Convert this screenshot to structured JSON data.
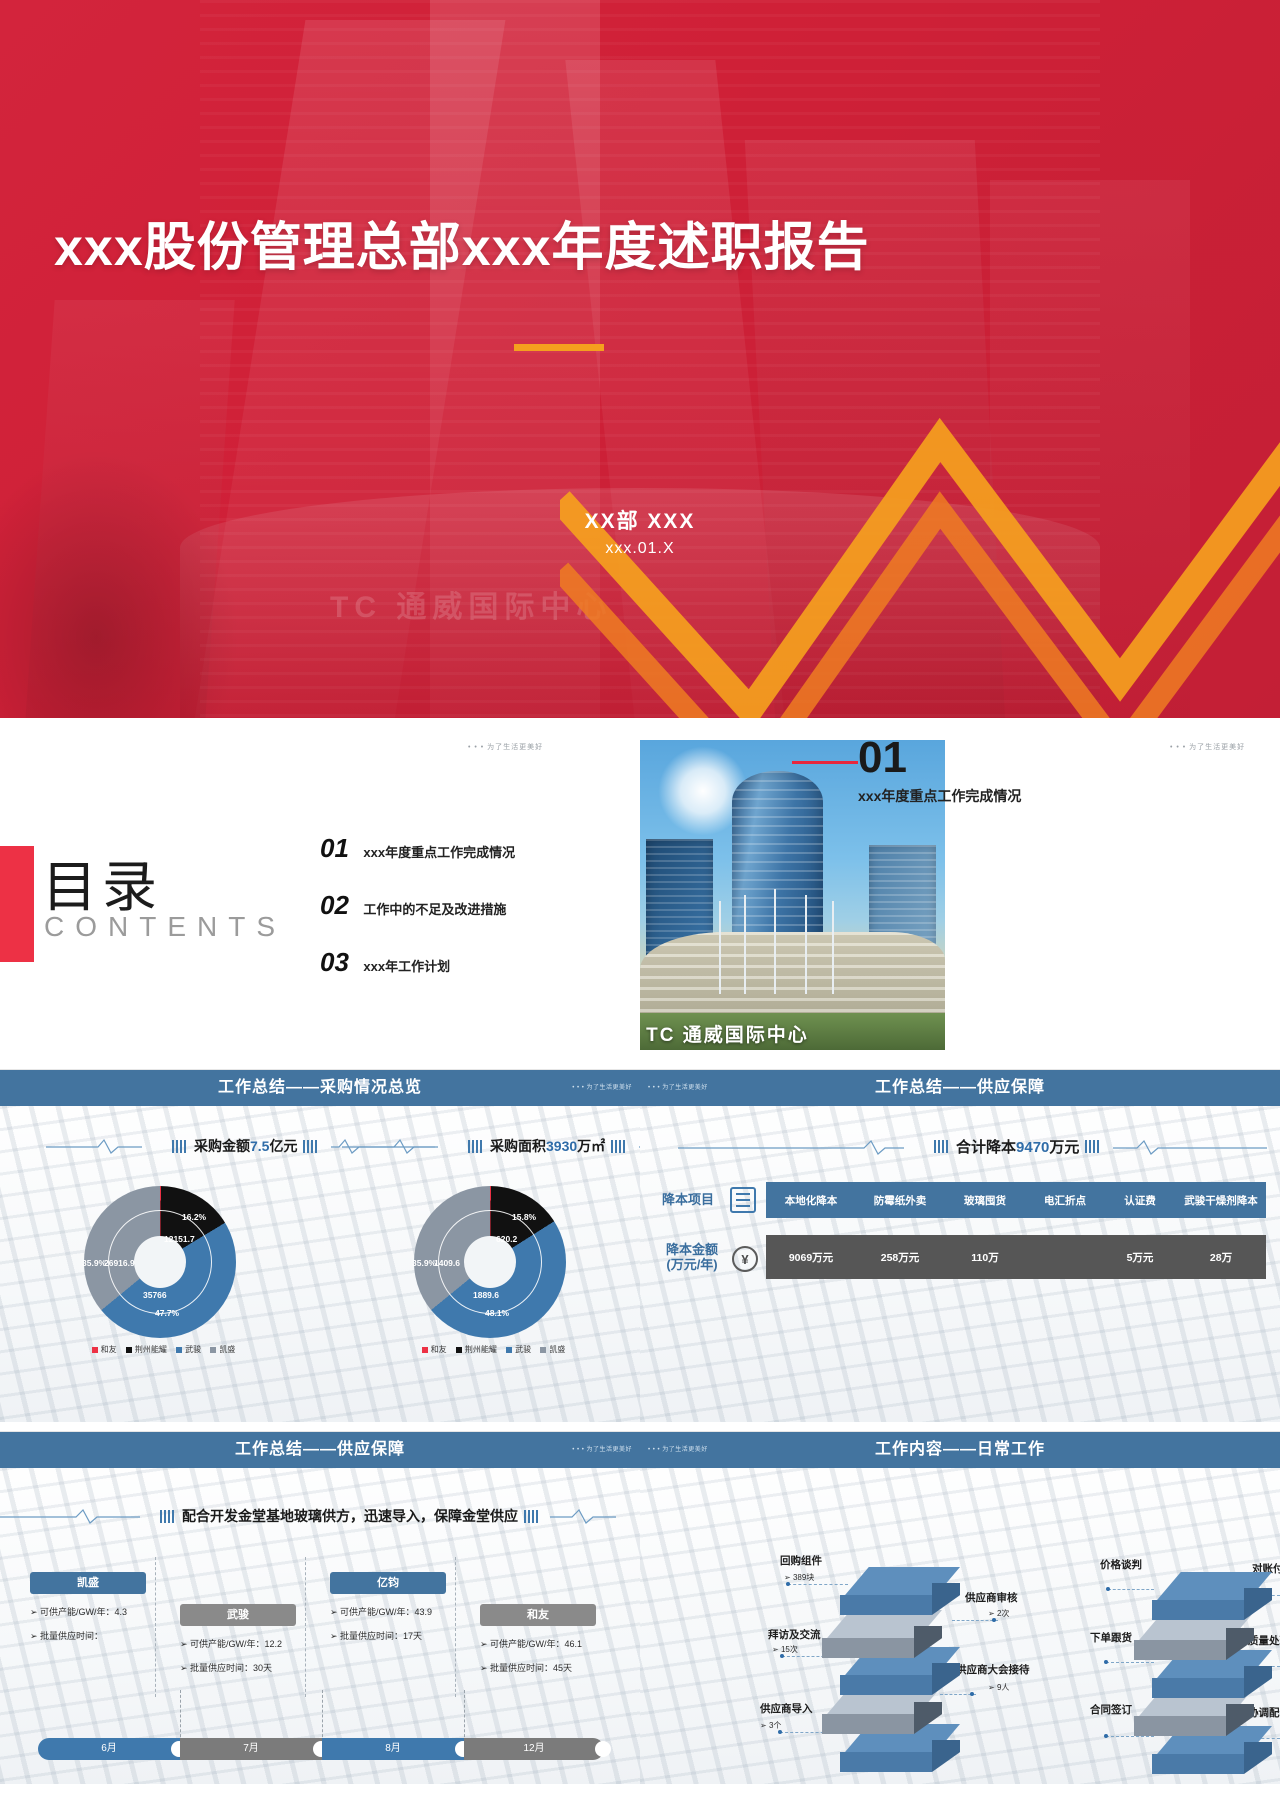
{
  "colors": {
    "brand_red": "#d3243c",
    "accent_orange": "#f5a01e",
    "header_blue": "#43749f",
    "table_gray": "#565656",
    "toc_red": "#ed3145"
  },
  "slide1": {
    "title": "xxx股份管理总部xxx年度述职报告",
    "presenter": "XX部  XXX",
    "date": "xxx.01.X",
    "watermark": "TC 通威国际中心"
  },
  "slide2": {
    "heading_cn": "目录",
    "heading_en": "CONTENTS",
    "corner_dots": "• • •  为了生活更美好",
    "toc": [
      {
        "num": "01",
        "label": "xxx年度重点工作完成情况"
      },
      {
        "num": "02",
        "label": "工作中的不足及改进措施"
      },
      {
        "num": "03",
        "label": "xxx年工作计划"
      }
    ],
    "section": {
      "num": "01",
      "label": "xxx年度重点工作完成情况",
      "photo_caption": "TC 通威国际中心"
    }
  },
  "slide3": {
    "header_title": "工作总结——采购情况总览",
    "header_dots": "• • •  为了生活更美好",
    "charts": [
      {
        "heading_prefix": "采购金额",
        "heading_value": "7.5",
        "heading_suffix": "亿元",
        "outer_labels": [
          "16.2%",
          "47.7%",
          "35.9%"
        ],
        "inner_labels": [
          "12151.7",
          "35766",
          "26916.9"
        ],
        "legend": [
          "和友",
          "荆州能耀",
          "武骏",
          "凯盛"
        ]
      },
      {
        "heading_prefix": "采购面积",
        "heading_value": "3930",
        "heading_suffix": "万㎡",
        "outer_labels": [
          "15.8%",
          "48.1%",
          "35.9%"
        ],
        "inner_labels": [
          "620.2",
          "1889.6",
          "1409.6"
        ],
        "legend": [
          "和友",
          "荆州能耀",
          "武骏",
          "凯盛"
        ]
      }
    ]
  },
  "slide4": {
    "header_title": "工作总结——供应保障",
    "header_dots": "• • •  为了生活更美好",
    "banner_prefix": "合计降本",
    "banner_value": "9470",
    "banner_suffix": "万元",
    "row_label_1": "降本项目",
    "row_label_2": "降本金额\n(万元/年)",
    "yen_symbol": "¥",
    "columns": [
      "本地化降本",
      "防霉纸外卖",
      "玻璃囤货",
      "电汇折点",
      "认证费",
      "武骏干燥剂降本"
    ],
    "values": [
      "9069万元",
      "258万元",
      "110万",
      "",
      "5万元",
      "28万"
    ]
  },
  "slide5": {
    "header_title": "工作总结——供应保障",
    "header_dots": "• • •  为了生活更美好",
    "banner": "配合开发金堂基地玻璃供方，迅速导入，保障金堂供应",
    "vendors": [
      {
        "name": "凯盛",
        "style": "blue",
        "lines": [
          "可供产能/GW/年：4.3",
          "批量供应时间："
        ]
      },
      {
        "name": "武骏",
        "style": "gray",
        "lines": [
          "可供产能/GW/年：12.2",
          "批量供应时间：30天"
        ]
      },
      {
        "name": "亿钧",
        "style": "blue",
        "lines": [
          "可供产能/GW/年：43.9",
          "批量供应时间：17天"
        ]
      },
      {
        "name": "和友",
        "style": "gray",
        "lines": [
          "可供产能/GW/年：46.1",
          "批量供应时间：45天"
        ]
      }
    ],
    "timeline": [
      "6月",
      "7月",
      "8月",
      "12月"
    ]
  },
  "slide6": {
    "header_title": "工作内容——日常工作",
    "header_dots": "• • •  为了生活更美好",
    "left_stack": [
      {
        "label": "回购组件",
        "value": "389块"
      },
      {
        "label": "供应商审核",
        "value": "2次"
      },
      {
        "label": "拜访及交流",
        "value": "15次"
      },
      {
        "label": "供应商大会接待",
        "value": "9人"
      },
      {
        "label": "供应商导入",
        "value": "3个"
      }
    ],
    "right_stack": [
      {
        "label": "价格谈判",
        "value": ""
      },
      {
        "label": "对账付款",
        "value": ""
      },
      {
        "label": "下单跟货",
        "value": ""
      },
      {
        "label": "质量处理",
        "value": ""
      },
      {
        "label": "合同签订",
        "value": ""
      },
      {
        "label": "协调配合",
        "value": ""
      }
    ]
  },
  "chart_data": [
    {
      "type": "pie",
      "title": "采购金额7.5亿元",
      "categories": [
        "和友",
        "荆州能耀",
        "武骏",
        "凯盛"
      ],
      "series": [
        {
          "name": "占比(%)",
          "values": [
            0.2,
            16.2,
            47.7,
            35.9
          ]
        },
        {
          "name": "金额(万元)",
          "values": [
            0,
            12151.7,
            35766,
            26916.9
          ]
        }
      ],
      "legend_position": "bottom",
      "grid": false
    },
    {
      "type": "pie",
      "title": "采购面积3930万㎡",
      "categories": [
        "和友",
        "荆州能耀",
        "武骏",
        "凯盛"
      ],
      "series": [
        {
          "name": "占比(%)",
          "values": [
            0.2,
            15.8,
            48.1,
            35.9
          ]
        },
        {
          "name": "面积(万㎡)",
          "values": [
            0,
            620.2,
            1889.6,
            1409.6
          ]
        }
      ],
      "legend_position": "bottom",
      "grid": false
    },
    {
      "type": "table",
      "title": "合计降本9470万元",
      "categories": [
        "本地化降本",
        "防霉纸外卖",
        "玻璃囤货",
        "电汇折点",
        "认证费",
        "武骏干燥剂降本"
      ],
      "values": [
        9069,
        258,
        110,
        null,
        5,
        28
      ],
      "ylabel": "降本金额(万元/年)"
    }
  ]
}
